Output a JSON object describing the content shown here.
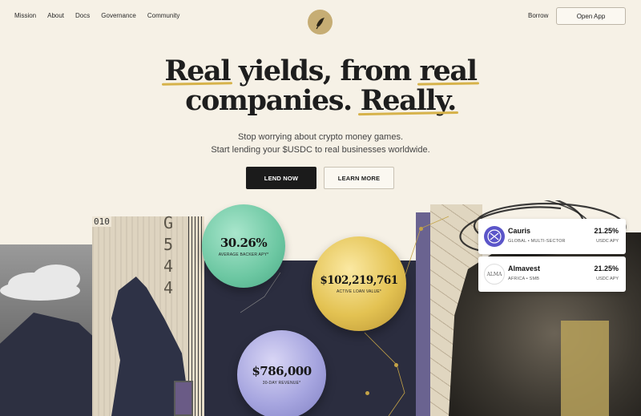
{
  "nav": {
    "links": [
      "Mission",
      "About",
      "Docs",
      "Governance",
      "Community"
    ],
    "borrow": "Borrow",
    "open_app": "Open App"
  },
  "hero": {
    "line1_a": "Real",
    "line1_b": " yields, from ",
    "line1_c": "real",
    "line2_a": "companies. ",
    "line2_b": "Really.",
    "subtitle_1": "Stop worrying about crypto money games.",
    "subtitle_2": "Start lending your $USDC to real businesses worldwide.",
    "lend_now": "LEND NOW",
    "learn_more": "LEARN MORE"
  },
  "collage": {
    "stamp_1": "010",
    "digits": [
      "G",
      "5",
      "4",
      "4"
    ]
  },
  "stats": [
    {
      "value": "30.26%",
      "caption": "AVERAGE BACKER APY*",
      "color": "#6cc7a2"
    },
    {
      "value": "$102,219,761",
      "caption": "ACTIVE LOAN VALUE*",
      "color": "#e3c252"
    },
    {
      "value": "$786,000",
      "caption": "30-DAY REVENUE*",
      "color": "#a6a5df"
    }
  ],
  "pools": [
    {
      "name": "Cauris",
      "region": "GLOBAL • MULTI-SECTOR",
      "rate": "21.25%",
      "apy_label": "USDC APY",
      "logo_color": "#5b55c9"
    },
    {
      "name": "Almavest",
      "region": "AFRICA • SMB",
      "rate": "21.25%",
      "apy_label": "USDC APY",
      "logo_text": "ALMA",
      "logo_color": "#ffffff"
    }
  ]
}
